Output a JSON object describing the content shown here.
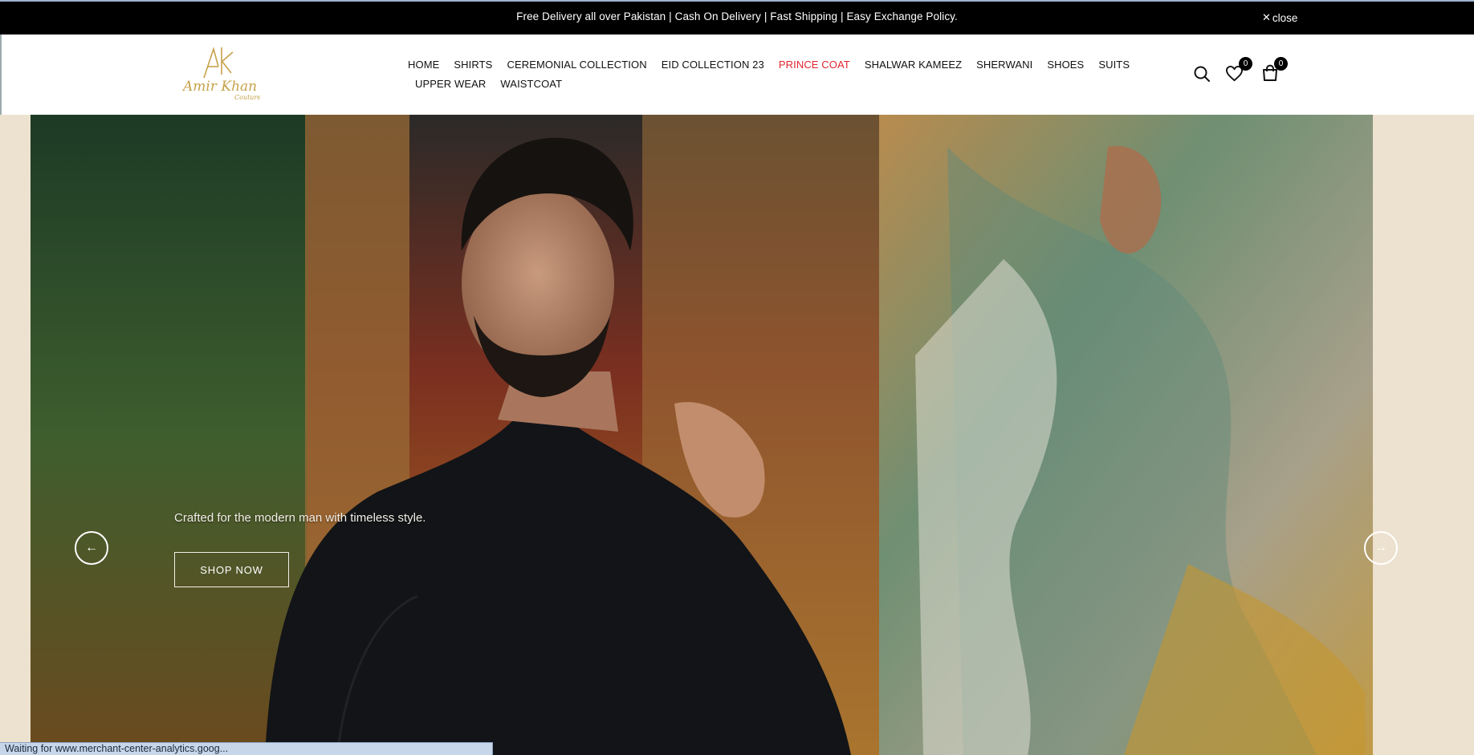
{
  "announcement": {
    "text": "Free Delivery all over Pakistan | Cash On Delivery | Fast Shipping | Easy Exchange Policy.",
    "close_label": "close",
    "close_icon": "close-icon"
  },
  "brand": {
    "logo_name": "Amir Khan Couture",
    "logo_text": "Amir Khan",
    "logo_sub": "Couture",
    "logo_mark": "AK",
    "colors": {
      "gold": "#c6a24a",
      "accent_red": "#e0252f"
    }
  },
  "nav": {
    "row1": [
      "HOME",
      "SHIRTS",
      "CEREMONIAL COLLECTION",
      "EID COLLECTION 23",
      "PRINCE COAT",
      "SHALWAR KAMEEZ",
      "SHERWANI",
      "SHOES",
      "SUITS"
    ],
    "row2": [
      "UPPER WEAR",
      "WAISTCOAT"
    ],
    "active": "PRINCE COAT"
  },
  "header_icons": {
    "search": "search-icon",
    "wishlist": "heart-icon",
    "wishlist_count": "0",
    "cart": "shopping-bag-icon",
    "cart_count": "0"
  },
  "hero": {
    "caption": "Crafted for the modern man with timeless style.",
    "button_label": "SHOP NOW",
    "prev_icon": "arrow-left-icon",
    "next_icon": "arrow-right-icon"
  },
  "statusbar": {
    "text": "Waiting for www.merchant-center-analytics.goog..."
  }
}
